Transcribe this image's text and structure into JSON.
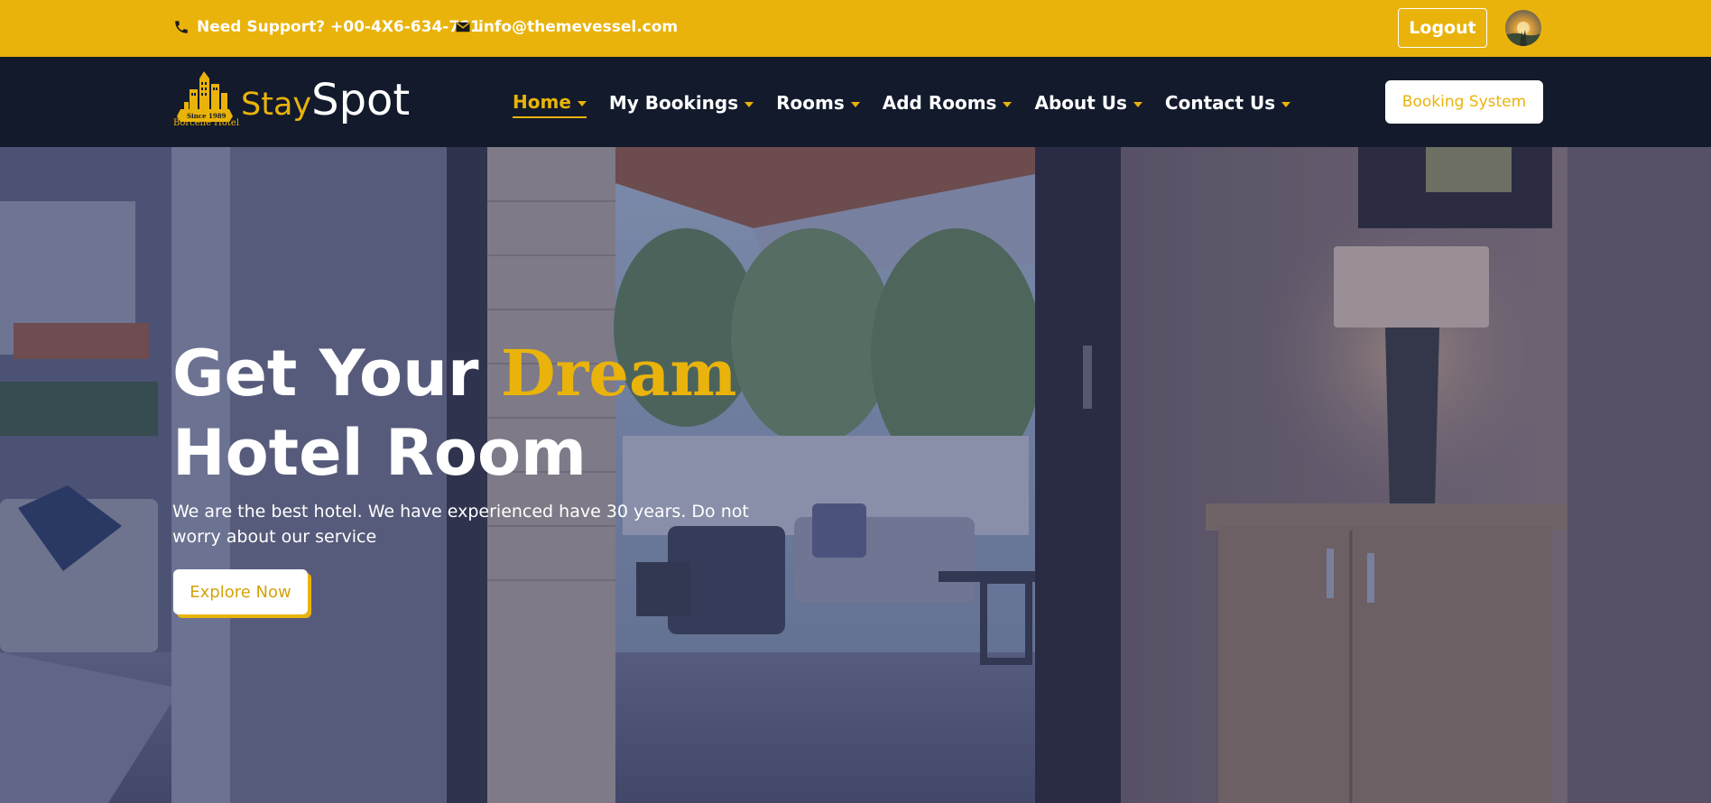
{
  "topbar": {
    "support_text": "Need Support? +00-4X6-634-781",
    "email_text": "info@themevessel.com",
    "logout_label": "Logout"
  },
  "brand": {
    "name_part1": "Stay",
    "name_part2": "Spot",
    "badge_text": "Since 1989",
    "tagline": "Borcelle Hotel"
  },
  "nav": {
    "items": [
      {
        "label": "Home",
        "active": true
      },
      {
        "label": "My Bookings"
      },
      {
        "label": "Rooms"
      },
      {
        "label": "Add Rooms"
      },
      {
        "label": "About Us"
      },
      {
        "label": "Contact Us"
      }
    ],
    "cta_label": "Booking System"
  },
  "hero": {
    "title_part1": "Get Your ",
    "title_accent": "Dream",
    "title_line2": "Hotel Room",
    "subtitle": "We are the best hotel. We have experienced have 30 years. Do not worry about our service",
    "button_label": "Explore Now"
  },
  "colors": {
    "accent": "#e9b30b",
    "navbar": "#121a2c",
    "text_light": "#ffffff"
  },
  "icons": {
    "phone": "phone-icon",
    "email": "envelope-icon",
    "caret": "caret-down-icon"
  }
}
